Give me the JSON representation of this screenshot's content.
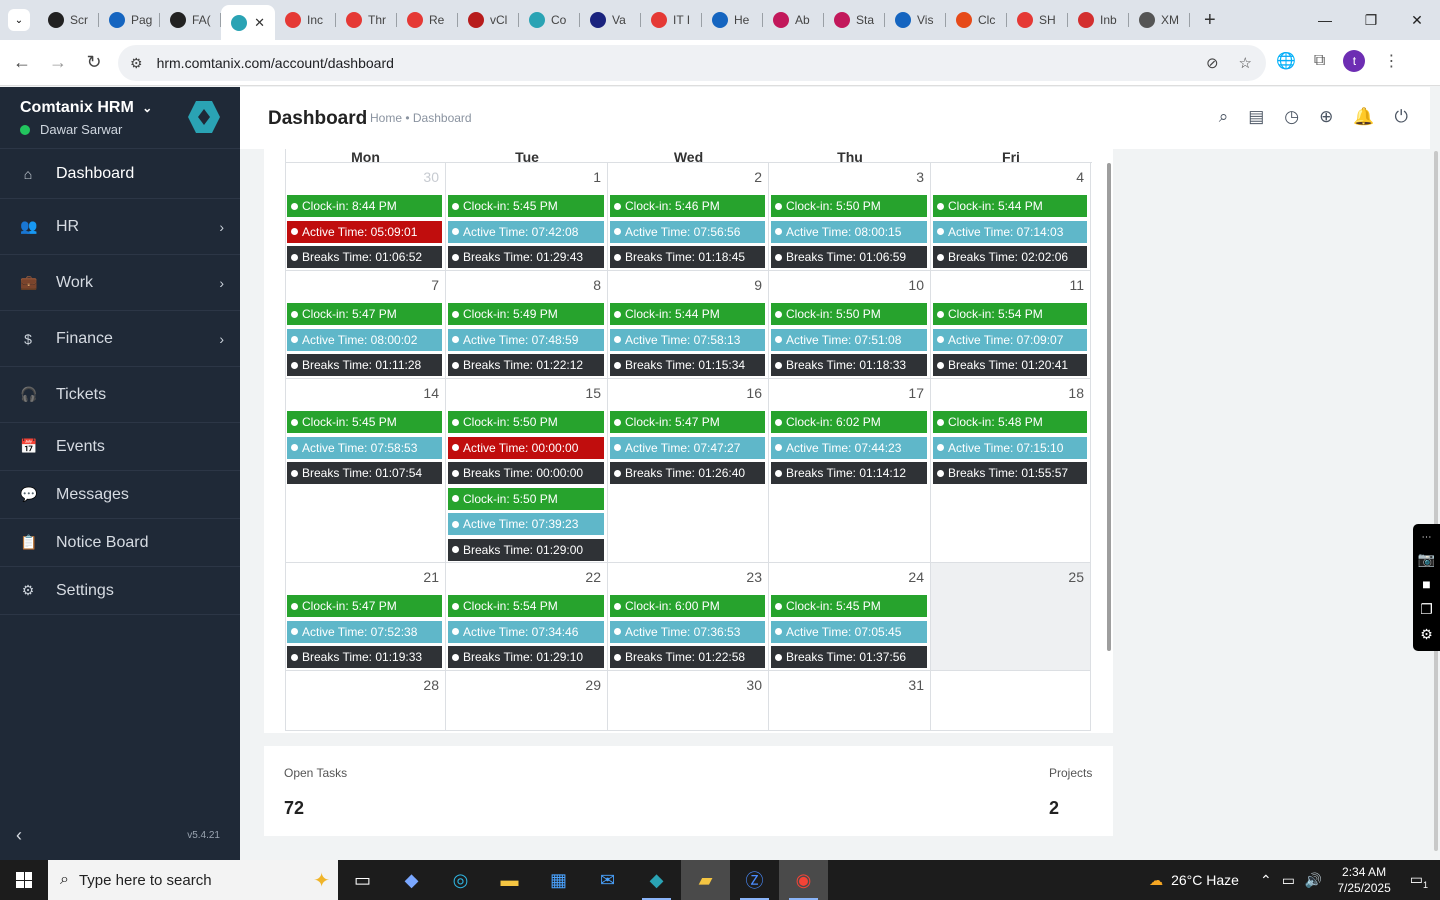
{
  "browser": {
    "tabs": [
      {
        "label": "Scr",
        "icon": "screencast-icon",
        "color": "#222"
      },
      {
        "label": "Pag",
        "icon": "wifi-icon",
        "color": "#1565c0"
      },
      {
        "label": "FA(",
        "icon": "openai-icon",
        "color": "#222"
      },
      {
        "label": "",
        "icon": "comtanix-icon",
        "color": "#2aa3b4",
        "active": true
      },
      {
        "label": "Inc",
        "icon": "tag-icon",
        "color": "#e53935"
      },
      {
        "label": "Thr",
        "icon": "tag-icon",
        "color": "#e53935"
      },
      {
        "label": "Re",
        "icon": "tag-icon",
        "color": "#e53935"
      },
      {
        "label": "vCl",
        "icon": "v-icon",
        "color": "#b71c1c"
      },
      {
        "label": "Co",
        "icon": "comtanix-icon",
        "color": "#2aa3b4"
      },
      {
        "label": "Va",
        "icon": "x-icon",
        "color": "#1a237e"
      },
      {
        "label": "IT I",
        "icon": "tag-icon",
        "color": "#e53935"
      },
      {
        "label": "He",
        "icon": "scale-icon",
        "color": "#1565c0"
      },
      {
        "label": "Ab",
        "icon": "ab-icon",
        "color": "#c2185b"
      },
      {
        "label": "Sta",
        "icon": "pen-icon",
        "color": "#c2185b"
      },
      {
        "label": "Vis",
        "icon": "pulse-icon",
        "color": "#1565c0"
      },
      {
        "label": "Clc",
        "icon": "claude-icon",
        "color": "#e64a19"
      },
      {
        "label": "SH",
        "icon": "circle-icon",
        "color": "#e53935"
      },
      {
        "label": "Inb",
        "icon": "gmail-icon",
        "color": "#d32f2f"
      },
      {
        "label": "XM",
        "icon": "globe-icon",
        "color": "#555"
      }
    ],
    "close_glyph": "✕",
    "url": "hrm.comtanix.com/account/dashboard",
    "profile_initial": "t"
  },
  "sidebar": {
    "company": "Comtanix HRM",
    "user": "Dawar Sarwar",
    "version": "v5.4.21",
    "items": [
      {
        "label": "Dashboard",
        "icon": "home-icon",
        "glyph": "⌂",
        "active": true
      },
      {
        "label": "HR",
        "icon": "users-icon",
        "glyph": "👥",
        "chevron": true
      },
      {
        "label": "Work",
        "icon": "briefcase-icon",
        "glyph": "💼",
        "chevron": true
      },
      {
        "label": "Finance",
        "icon": "dollar-icon",
        "glyph": "$",
        "chevron": true
      },
      {
        "label": "Tickets",
        "icon": "headset-icon",
        "glyph": "🎧"
      },
      {
        "label": "Events",
        "icon": "calendar-icon",
        "glyph": "📅"
      },
      {
        "label": "Messages",
        "icon": "message-icon",
        "glyph": "💬"
      },
      {
        "label": "Notice Board",
        "icon": "clipboard-icon",
        "glyph": "📋"
      },
      {
        "label": "Settings",
        "icon": "gear-icon",
        "glyph": "⚙"
      }
    ]
  },
  "header": {
    "title": "Dashboard",
    "breadcrumb": "Home • Dashboard"
  },
  "calendar": {
    "weekdays": [
      "Mon",
      "Tue",
      "Wed",
      "Thu",
      "Fri"
    ],
    "weeks": [
      {
        "days": [
          {
            "num": "30",
            "muted": true,
            "events": [
              [
                "g",
                "Clock-in: 8:44 PM"
              ],
              [
                "r",
                "Active Time: 05:09:01"
              ],
              [
                "d",
                "Breaks Time: 01:06:52"
              ]
            ]
          },
          {
            "num": "1",
            "events": [
              [
                "g",
                "Clock-in: 5:45 PM"
              ],
              [
                "b",
                "Active Time: 07:42:08"
              ],
              [
                "d",
                "Breaks Time: 01:29:43"
              ]
            ]
          },
          {
            "num": "2",
            "events": [
              [
                "g",
                "Clock-in: 5:46 PM"
              ],
              [
                "b",
                "Active Time: 07:56:56"
              ],
              [
                "d",
                "Breaks Time: 01:18:45"
              ]
            ]
          },
          {
            "num": "3",
            "events": [
              [
                "g",
                "Clock-in: 5:50 PM"
              ],
              [
                "b",
                "Active Time: 08:00:15"
              ],
              [
                "d",
                "Breaks Time: 01:06:59"
              ]
            ]
          },
          {
            "num": "4",
            "events": [
              [
                "g",
                "Clock-in: 5:44 PM"
              ],
              [
                "b",
                "Active Time: 07:14:03"
              ],
              [
                "d",
                "Breaks Time: 02:02:06"
              ]
            ]
          }
        ]
      },
      {
        "days": [
          {
            "num": "7",
            "events": [
              [
                "g",
                "Clock-in: 5:47 PM"
              ],
              [
                "b",
                "Active Time: 08:00:02"
              ],
              [
                "d",
                "Breaks Time: 01:11:28"
              ]
            ]
          },
          {
            "num": "8",
            "events": [
              [
                "g",
                "Clock-in: 5:49 PM"
              ],
              [
                "b",
                "Active Time: 07:48:59"
              ],
              [
                "d",
                "Breaks Time: 01:22:12"
              ]
            ]
          },
          {
            "num": "9",
            "events": [
              [
                "g",
                "Clock-in: 5:44 PM"
              ],
              [
                "b",
                "Active Time: 07:58:13"
              ],
              [
                "d",
                "Breaks Time: 01:15:34"
              ]
            ]
          },
          {
            "num": "10",
            "events": [
              [
                "g",
                "Clock-in: 5:50 PM"
              ],
              [
                "b",
                "Active Time: 07:51:08"
              ],
              [
                "d",
                "Breaks Time: 01:18:33"
              ]
            ]
          },
          {
            "num": "11",
            "events": [
              [
                "g",
                "Clock-in: 5:54 PM"
              ],
              [
                "b",
                "Active Time: 07:09:07"
              ],
              [
                "d",
                "Breaks Time: 01:20:41"
              ]
            ]
          }
        ]
      },
      {
        "days": [
          {
            "num": "14",
            "events": [
              [
                "g",
                "Clock-in: 5:45 PM"
              ],
              [
                "b",
                "Active Time: 07:58:53"
              ],
              [
                "d",
                "Breaks Time: 01:07:54"
              ]
            ]
          },
          {
            "num": "15",
            "events": [
              [
                "g",
                "Clock-in: 5:50 PM"
              ],
              [
                "r",
                "Active Time: 00:00:00"
              ],
              [
                "d",
                "Breaks Time: 00:00:00"
              ],
              [
                "g",
                "Clock-in: 5:50 PM"
              ],
              [
                "b",
                "Active Time: 07:39:23"
              ],
              [
                "d",
                "Breaks Time: 01:29:00"
              ]
            ]
          },
          {
            "num": "16",
            "events": [
              [
                "g",
                "Clock-in: 5:47 PM"
              ],
              [
                "b",
                "Active Time: 07:47:27"
              ],
              [
                "d",
                "Breaks Time: 01:26:40"
              ]
            ]
          },
          {
            "num": "17",
            "events": [
              [
                "g",
                "Clock-in: 6:02 PM"
              ],
              [
                "b",
                "Active Time: 07:44:23"
              ],
              [
                "d",
                "Breaks Time: 01:14:12"
              ]
            ]
          },
          {
            "num": "18",
            "events": [
              [
                "g",
                "Clock-in: 5:48 PM"
              ],
              [
                "b",
                "Active Time: 07:15:10"
              ],
              [
                "d",
                "Breaks Time: 01:55:57"
              ]
            ]
          }
        ]
      },
      {
        "days": [
          {
            "num": "21",
            "events": [
              [
                "g",
                "Clock-in: 5:47 PM"
              ],
              [
                "b",
                "Active Time: 07:52:38"
              ],
              [
                "d",
                "Breaks Time: 01:19:33"
              ]
            ]
          },
          {
            "num": "22",
            "events": [
              [
                "g",
                "Clock-in: 5:54 PM"
              ],
              [
                "b",
                "Active Time: 07:34:46"
              ],
              [
                "d",
                "Breaks Time: 01:29:10"
              ]
            ]
          },
          {
            "num": "23",
            "events": [
              [
                "g",
                "Clock-in: 6:00 PM"
              ],
              [
                "b",
                "Active Time: 07:36:53"
              ],
              [
                "d",
                "Breaks Time: 01:22:58"
              ]
            ]
          },
          {
            "num": "24",
            "events": [
              [
                "g",
                "Clock-in: 5:45 PM"
              ],
              [
                "b",
                "Active Time: 07:05:45"
              ],
              [
                "d",
                "Breaks Time: 01:37:56"
              ]
            ]
          },
          {
            "num": "25",
            "gray": true,
            "events": []
          }
        ]
      },
      {
        "days": [
          {
            "num": "28",
            "events": []
          },
          {
            "num": "29",
            "events": []
          },
          {
            "num": "30",
            "events": []
          },
          {
            "num": "31",
            "events": []
          },
          {
            "num": "",
            "events": []
          }
        ]
      }
    ]
  },
  "stats": {
    "open_tasks_label": "Open Tasks",
    "open_tasks_value": "72",
    "projects_label": "Projects",
    "projects_value": "2"
  },
  "taskbar": {
    "search_placeholder": "Type here to search",
    "weather": "26°C  Haze",
    "time": "2:34 AM",
    "date": "7/25/2025",
    "notification_count": "1"
  }
}
